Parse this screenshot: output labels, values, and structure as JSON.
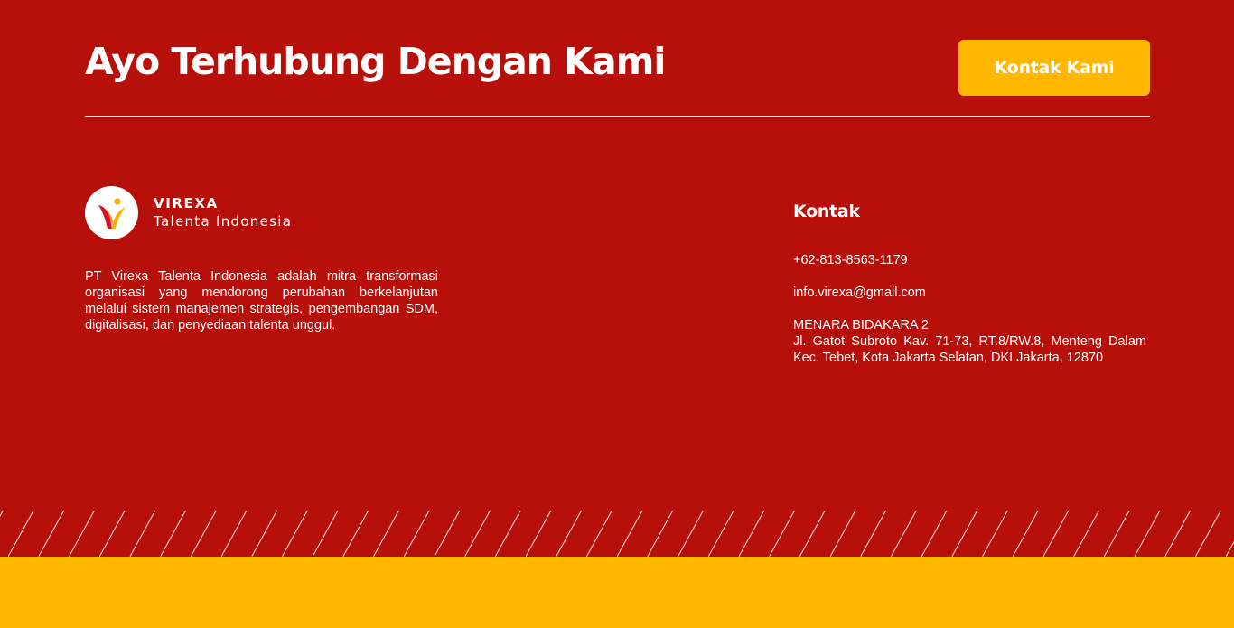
{
  "cta": {
    "title": "Ayo Terhubung Dengan Kami",
    "button_label": "Kontak Kami"
  },
  "brand": {
    "name": "VIREXA",
    "tagline": "Talenta Indonesia",
    "logo_icon": "virexa-v-logo-icon",
    "description": "PT Virexa Talenta Indonesia adalah mitra transformasi organisasi yang mendorong perubahan berkelanjutan melalui sistem manajemen strategis, pengembangan SDM, digitalisasi, dan penyediaan talenta unggul."
  },
  "contact": {
    "heading": "Kontak",
    "phone": "+62-813-8563-1179",
    "email": "info.virexa@gmail.com",
    "address_title": "MENARA BIDAKARA 2",
    "address": "Jl. Gatot Subroto Kav. 71-73, RT.8/RW.8, Menteng Dalam Kec. Tebet, Kota Jakarta Selatan, DKI Jakarta, 12870"
  },
  "colors": {
    "background": "#B70F0A",
    "accent": "#FFB700",
    "text": "#FFFFFF"
  },
  "decor": {
    "stripe_pattern": "diagonal-white-lines",
    "bottom_band_color": "#FFB700"
  }
}
